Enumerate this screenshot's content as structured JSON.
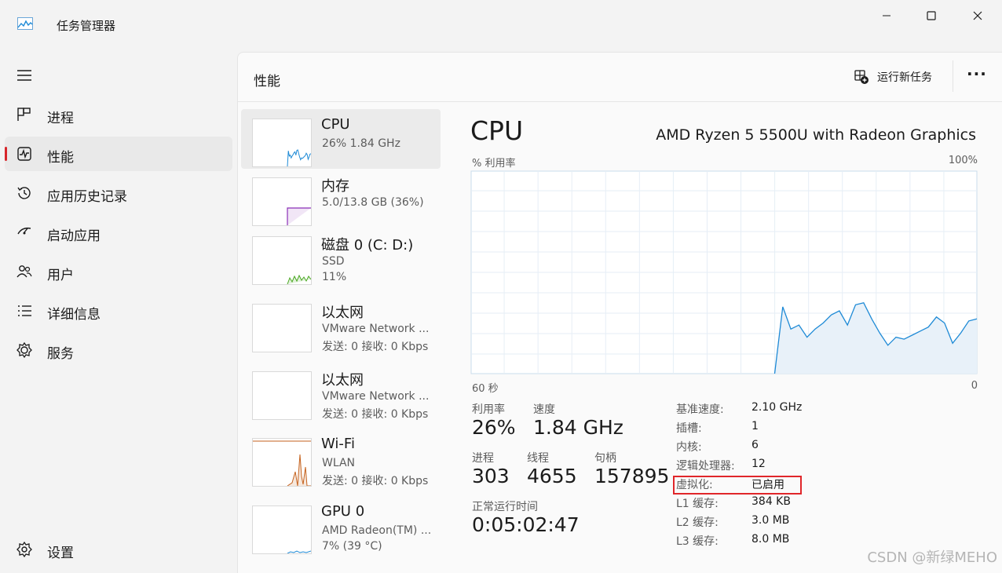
{
  "window": {
    "title": "任务管理器"
  },
  "nav": {
    "items": [
      {
        "label": "进程",
        "icon": "processes-icon"
      },
      {
        "label": "性能",
        "icon": "performance-icon"
      },
      {
        "label": "应用历史记录",
        "icon": "app-history-icon"
      },
      {
        "label": "启动应用",
        "icon": "startup-apps-icon"
      },
      {
        "label": "用户",
        "icon": "users-icon"
      },
      {
        "label": "详细信息",
        "icon": "details-icon"
      },
      {
        "label": "服务",
        "icon": "services-icon"
      }
    ],
    "settings_label": "设置",
    "active_index": 1
  },
  "header": {
    "title": "性能",
    "run_task_label": "运行新任务",
    "more_label": "···"
  },
  "resources": [
    {
      "name": "CPU",
      "sub1": "26%  1.84 GHz",
      "sub2": ""
    },
    {
      "name": "内存",
      "sub1": "5.0/13.8 GB (36%)",
      "sub2": ""
    },
    {
      "name": "磁盘 0 (C: D:)",
      "sub1": "SSD",
      "sub2": "11%"
    },
    {
      "name": "以太网",
      "sub1": "VMware Network ...",
      "sub2": "发送: 0 接收: 0 Kbps"
    },
    {
      "name": "以太网",
      "sub1": "VMware Network ...",
      "sub2": "发送: 0 接收: 0 Kbps"
    },
    {
      "name": "Wi-Fi",
      "sub1": "WLAN",
      "sub2": "发送: 0 接收: 0 Kbps"
    },
    {
      "name": "GPU 0",
      "sub1": "AMD Radeon(TM) ...",
      "sub2": "7% (39 °C)"
    }
  ],
  "detail": {
    "title": "CPU",
    "model": "AMD Ryzen 5 5500U with Radeon Graphics",
    "y_label": "% 利用率",
    "y_max_label": "100%",
    "x_left_label": "60 秒",
    "x_right_label": "0",
    "stats": {
      "utilization_label": "利用率",
      "utilization_value": "26%",
      "speed_label": "速度",
      "speed_value": "1.84 GHz",
      "processes_label": "进程",
      "processes_value": "303",
      "threads_label": "线程",
      "threads_value": "4655",
      "handles_label": "句柄",
      "handles_value": "157895",
      "uptime_label": "正常运行时间",
      "uptime_value": "0:05:02:47"
    },
    "specs": [
      {
        "label": "基准速度:",
        "value": "2.10 GHz"
      },
      {
        "label": "插槽:",
        "value": "1"
      },
      {
        "label": "内核:",
        "value": "6"
      },
      {
        "label": "逻辑处理器:",
        "value": "12"
      },
      {
        "label": "虚拟化:",
        "value": "已启用"
      },
      {
        "label": "L1 缓存:",
        "value": "384 KB"
      },
      {
        "label": "L2 缓存:",
        "value": "3.0 MB"
      },
      {
        "label": "L3 缓存:",
        "value": "8.0 MB"
      }
    ]
  },
  "cpu_history_percent": [
    0,
    33,
    22,
    24,
    18,
    22,
    25,
    29,
    31,
    24,
    34,
    35,
    27,
    20,
    14,
    18,
    17,
    19,
    21,
    23,
    28,
    25,
    15,
    20,
    26,
    27
  ],
  "watermark": "CSDN @新绿MEHO",
  "colors": {
    "cpu_line": "#1e8ad6",
    "cpu_fill": "#e8f1f9",
    "memory_line": "#8b2fb7",
    "disk_line": "#4aa822",
    "wifi_line": "#c5621e",
    "gpu_line": "#1e8ad6",
    "highlight": "#e0262a",
    "active_bar": "#d7262b"
  }
}
